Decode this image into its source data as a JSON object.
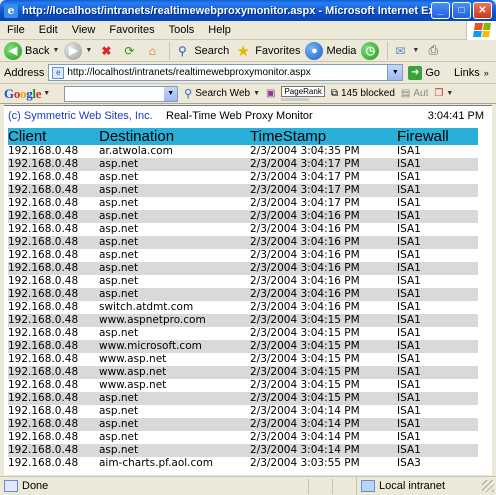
{
  "window": {
    "title": "http://localhost/intranets/realtimewebproxymonitor.aspx - Microsoft Internet Explorer"
  },
  "menu": [
    "File",
    "Edit",
    "View",
    "Favorites",
    "Tools",
    "Help"
  ],
  "toolbar": {
    "back": "Back",
    "search": "Search",
    "favorites": "Favorites",
    "media": "Media"
  },
  "address": {
    "label": "Address",
    "url": "http://localhost/intranets/realtimewebproxymonitor.aspx",
    "go": "Go",
    "links": "Links"
  },
  "googlebar": {
    "logo": "Google",
    "search_web": "Search Web",
    "pagerank": "PageRank",
    "blocked": "145 blocked",
    "autofill": "Aut"
  },
  "page": {
    "company": "(c) Symmetric Web Sites, Inc.",
    "title": "Real-Time Web Proxy Monitor",
    "clock": "3:04:41 PM",
    "columns": [
      "Client",
      "Destination",
      "TimeStamp",
      "Firewall"
    ],
    "rows": [
      [
        "192.168.0.48",
        "ar.atwola.com",
        "2/3/2004 3:04:35 PM",
        "ISA1"
      ],
      [
        "192.168.0.48",
        "asp.net",
        "2/3/2004 3:04:17 PM",
        "ISA1"
      ],
      [
        "192.168.0.48",
        "asp.net",
        "2/3/2004 3:04:17 PM",
        "ISA1"
      ],
      [
        "192.168.0.48",
        "asp.net",
        "2/3/2004 3:04:17 PM",
        "ISA1"
      ],
      [
        "192.168.0.48",
        "asp.net",
        "2/3/2004 3:04:17 PM",
        "ISA1"
      ],
      [
        "192.168.0.48",
        "asp.net",
        "2/3/2004 3:04:16 PM",
        "ISA1"
      ],
      [
        "192.168.0.48",
        "asp.net",
        "2/3/2004 3:04:16 PM",
        "ISA1"
      ],
      [
        "192.168.0.48",
        "asp.net",
        "2/3/2004 3:04:16 PM",
        "ISA1"
      ],
      [
        "192.168.0.48",
        "asp.net",
        "2/3/2004 3:04:16 PM",
        "ISA1"
      ],
      [
        "192.168.0.48",
        "asp.net",
        "2/3/2004 3:04:16 PM",
        "ISA1"
      ],
      [
        "192.168.0.48",
        "asp.net",
        "2/3/2004 3:04:16 PM",
        "ISA1"
      ],
      [
        "192.168.0.48",
        "asp.net",
        "2/3/2004 3:04:16 PM",
        "ISA1"
      ],
      [
        "192.168.0.48",
        "switch.atdmt.com",
        "2/3/2004 3:04:16 PM",
        "ISA1"
      ],
      [
        "192.168.0.48",
        "www.aspnetpro.com",
        "2/3/2004 3:04:15 PM",
        "ISA1"
      ],
      [
        "192.168.0.48",
        "asp.net",
        "2/3/2004 3:04:15 PM",
        "ISA1"
      ],
      [
        "192.168.0.48",
        "www.microsoft.com",
        "2/3/2004 3:04:15 PM",
        "ISA1"
      ],
      [
        "192.168.0.48",
        "www.asp.net",
        "2/3/2004 3:04:15 PM",
        "ISA1"
      ],
      [
        "192.168.0.48",
        "www.asp.net",
        "2/3/2004 3:04:15 PM",
        "ISA1"
      ],
      [
        "192.168.0.48",
        "www.asp.net",
        "2/3/2004 3:04:15 PM",
        "ISA1"
      ],
      [
        "192.168.0.48",
        "asp.net",
        "2/3/2004 3:04:15 PM",
        "ISA1"
      ],
      [
        "192.168.0.48",
        "asp.net",
        "2/3/2004 3:04:14 PM",
        "ISA1"
      ],
      [
        "192.168.0.48",
        "asp.net",
        "2/3/2004 3:04:14 PM",
        "ISA1"
      ],
      [
        "192.168.0.48",
        "asp.net",
        "2/3/2004 3:04:14 PM",
        "ISA1"
      ],
      [
        "192.168.0.48",
        "asp.net",
        "2/3/2004 3:04:14 PM",
        "ISA1"
      ],
      [
        "192.168.0.48",
        "aim-charts.pf.aol.com",
        "2/3/2004 3:03:55 PM",
        "ISA3"
      ]
    ]
  },
  "status": {
    "left": "Done",
    "zone": "Local intranet"
  },
  "colors": {
    "header_bg": "#2ab0d8",
    "alt_row": "#d9d9d9",
    "company_link": "#1a3bc8",
    "titlebar": "#0a52c8"
  },
  "icons": [
    "ie-icon",
    "back-arrow-icon",
    "forward-arrow-icon",
    "stop-icon",
    "refresh-icon",
    "home-icon",
    "search-icon",
    "favorites-star-icon",
    "media-icon",
    "history-icon",
    "mail-icon",
    "print-icon",
    "page-icon",
    "go-arrow-icon",
    "windows-flag-icon"
  ]
}
